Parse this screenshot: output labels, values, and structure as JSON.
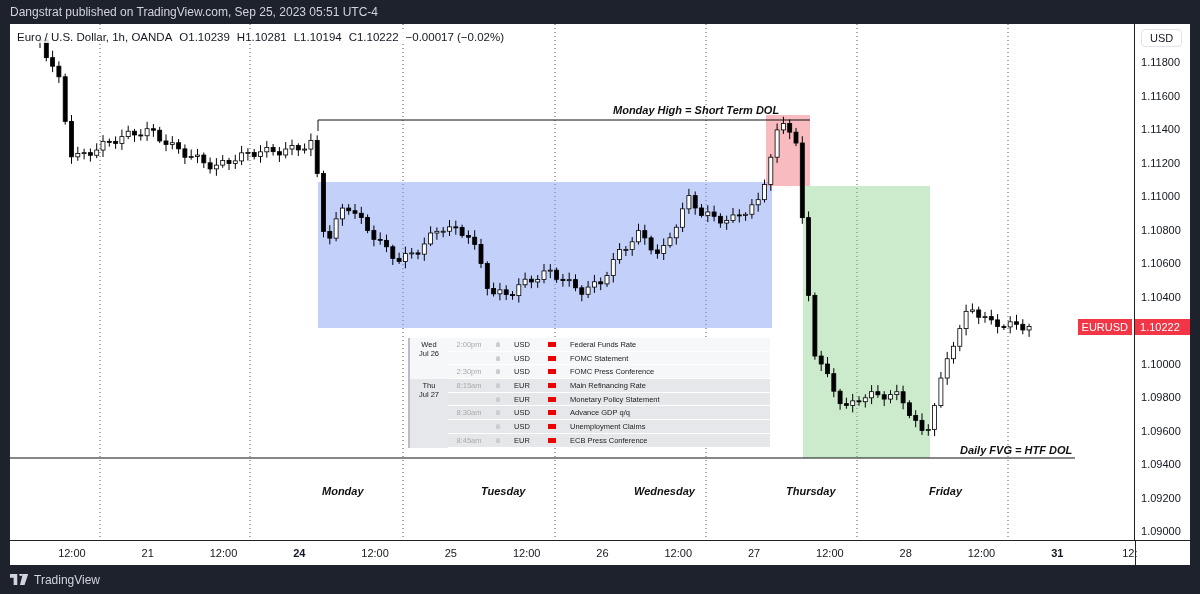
{
  "header": {
    "text": "Dangstrat published on TradingView.com, Sep 25, 2023 05:51 UTC-4"
  },
  "legend": [
    "Euro / U.S. Dollar, 1h, OANDA",
    "O1.10239",
    "H1.10281",
    "L1.10194",
    "C1.10222",
    "−0.00017 (−0.02%)"
  ],
  "price_axis": {
    "currency": "USD",
    "ticks": [
      "1.11800",
      "1.11600",
      "1.11400",
      "1.11200",
      "1.11000",
      "1.10800",
      "1.10600",
      "1.10400",
      "1.10000",
      "1.09800",
      "1.09600",
      "1.09400",
      "1.09200",
      "1.09000"
    ]
  },
  "last_price": {
    "symbol": "EURUSD",
    "value": "1.10222"
  },
  "annotations": {
    "top_label": "Monday High = Short Term DOL",
    "bottom_label": "Daily FVG = HTF DOL"
  },
  "day_labels": [
    "Monday",
    "Tuesday",
    "Wednesday",
    "Thursday",
    "Friday"
  ],
  "events": [
    {
      "day": "Wed",
      "date": "Jul 26",
      "rows": [
        {
          "time": "2:00pm",
          "currency": "USD",
          "title": "Federal Funds Rate"
        },
        {
          "time": "",
          "currency": "USD",
          "title": "FOMC Statement"
        },
        {
          "time": "2:30pm",
          "currency": "USD",
          "title": "FOMC Press Conference"
        }
      ]
    },
    {
      "day": "Thu",
      "date": "Jul 27",
      "rows": [
        {
          "time": "8:15am",
          "currency": "EUR",
          "title": "Main Refinancing Rate"
        },
        {
          "time": "",
          "currency": "EUR",
          "title": "Monetary Policy Statement"
        },
        {
          "time": "8:30am",
          "currency": "USD",
          "title": "Advance GDP q/q"
        },
        {
          "time": "",
          "currency": "USD",
          "title": "Unemployment Claims"
        },
        {
          "time": "8:45am",
          "currency": "EUR",
          "title": "ECB Press Conference"
        }
      ]
    }
  ],
  "time_axis": [
    {
      "label": "12:00",
      "bold": false
    },
    {
      "label": "21",
      "bold": false
    },
    {
      "label": "12:00",
      "bold": false
    },
    {
      "label": "24",
      "bold": true
    },
    {
      "label": "12:00",
      "bold": false
    },
    {
      "label": "25",
      "bold": false
    },
    {
      "label": "12:00",
      "bold": false
    },
    {
      "label": "26",
      "bold": false
    },
    {
      "label": "12:00",
      "bold": false
    },
    {
      "label": "27",
      "bold": false
    },
    {
      "label": "12:00",
      "bold": false
    },
    {
      "label": "28",
      "bold": false
    },
    {
      "label": "12:00",
      "bold": false
    },
    {
      "label": "31",
      "bold": true
    },
    {
      "label": "12:",
      "bold": false
    }
  ],
  "footer": {
    "brand": "TradingView"
  }
}
